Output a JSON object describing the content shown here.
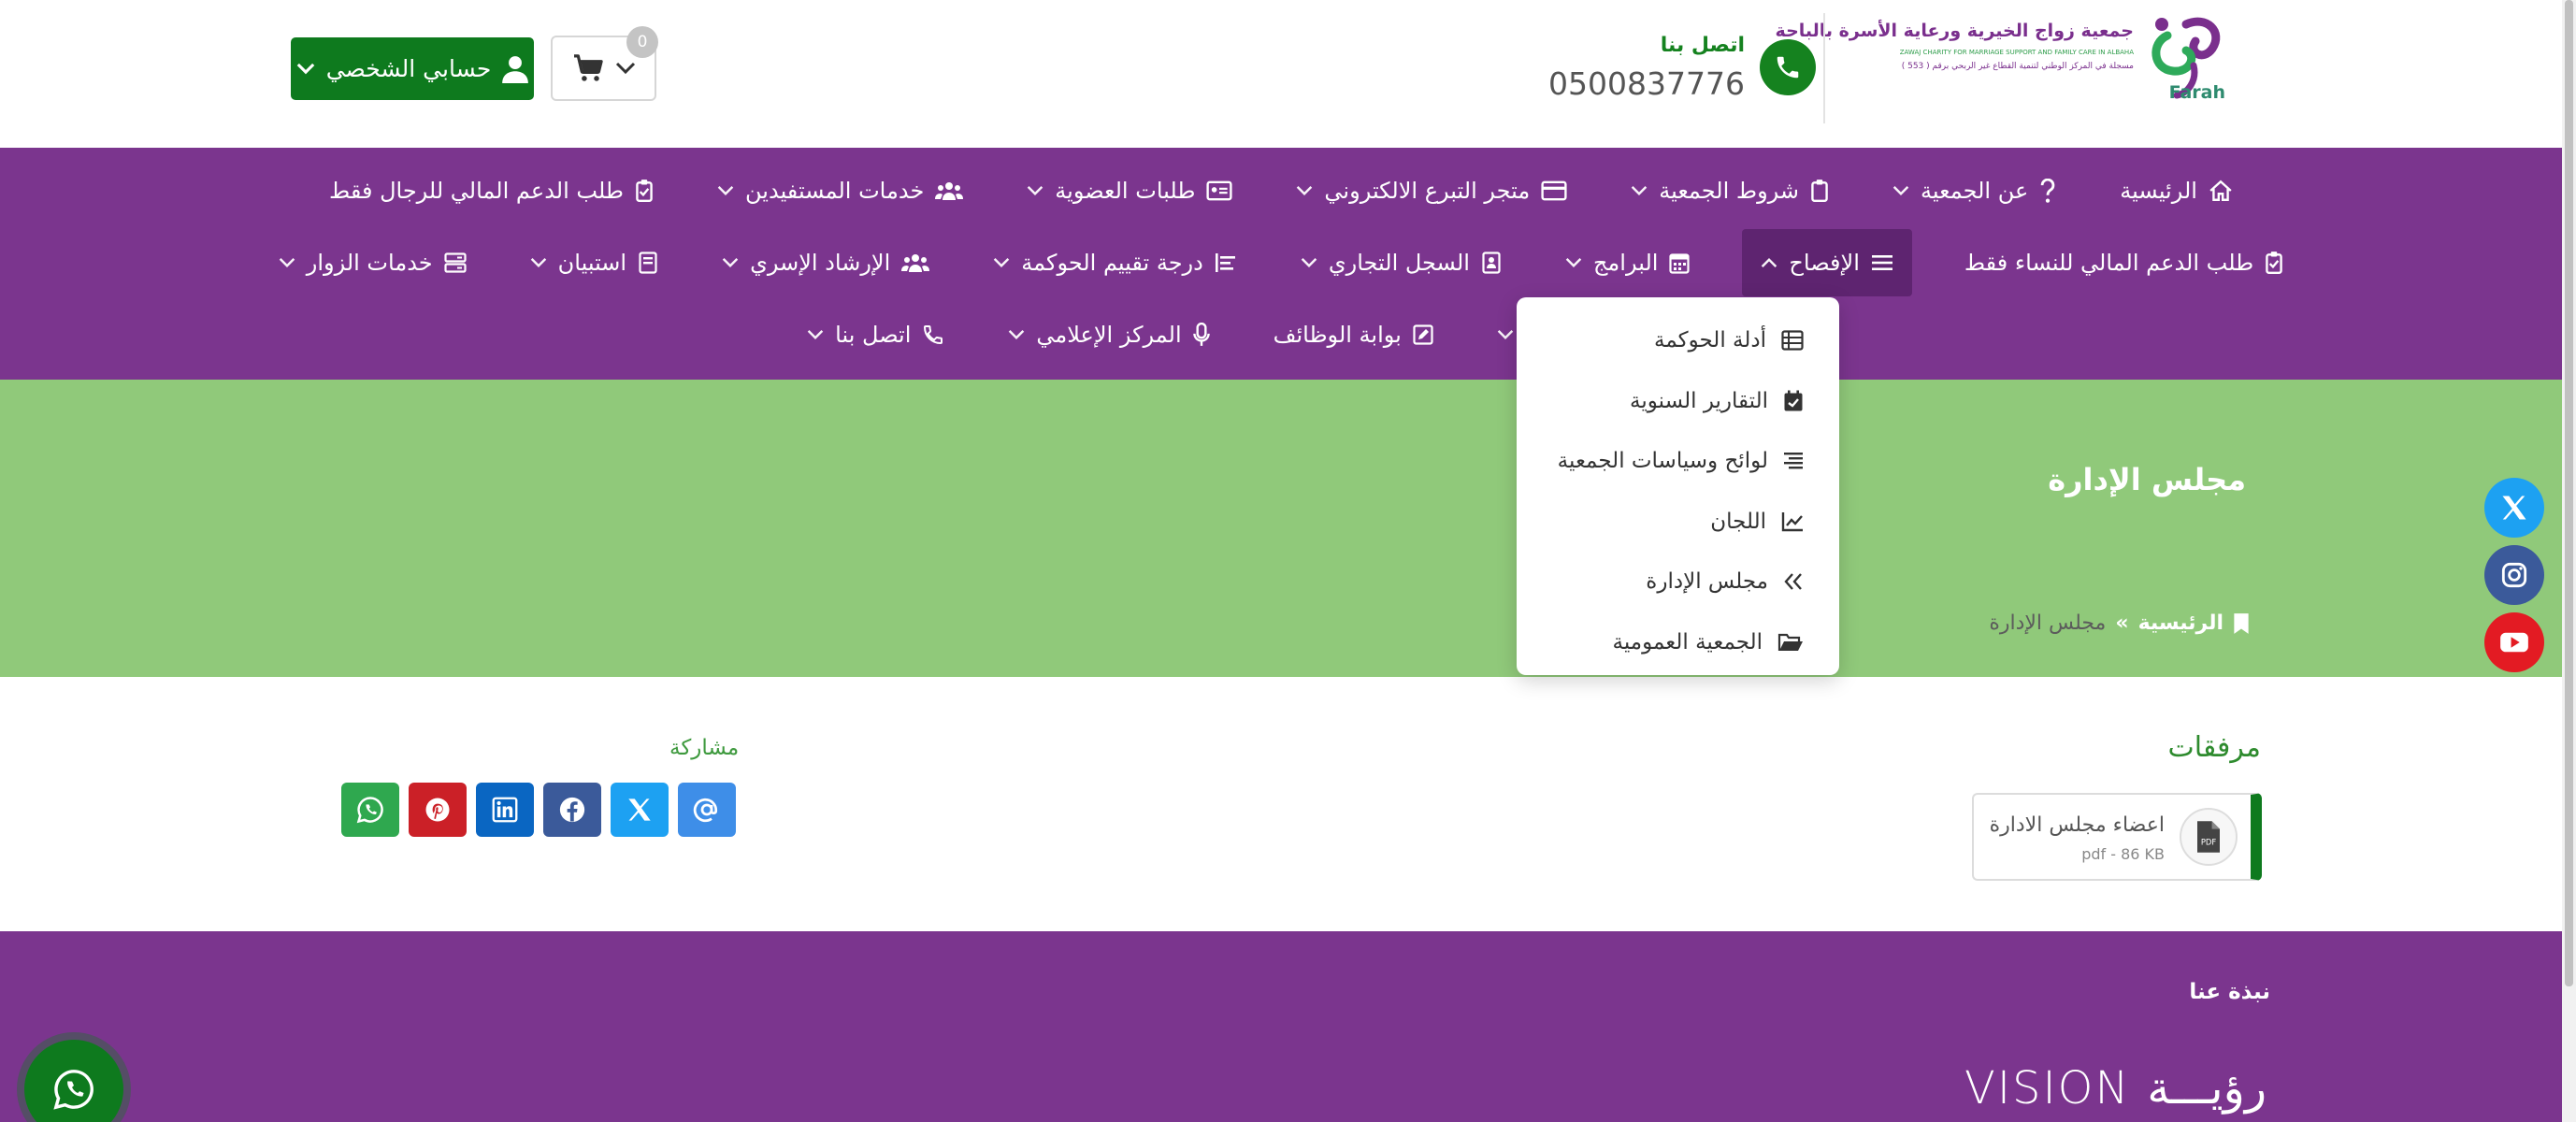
{
  "header": {
    "logo_text_ar": "جمعية زواج الخيرية ورعاية الأسرة بالباحة",
    "logo_text_en": "ZAWAJ CHARITY FOR MARRIAGE SUPPORT AND FAMILY CARE IN ALBAHA",
    "logo_text_reg": "مسجلة في المركز الوطني لتنمية القطاع غير الربحي برقم ( 553 )",
    "logo_brand": "Farah",
    "contact_label": "اتصل بنا",
    "contact_number": "0500837776",
    "cart_count": "0",
    "account_label": "حسابي الشخصي"
  },
  "nav": {
    "row1": [
      {
        "label": "الرئيسية",
        "icon": "home-icon",
        "dropdown": false
      },
      {
        "label": "عن الجمعية",
        "icon": "question-icon",
        "dropdown": true
      },
      {
        "label": "شروط الجمعية",
        "icon": "clipboard-icon",
        "dropdown": true
      },
      {
        "label": "متجر التبرع الالكتروني",
        "icon": "credit-card-icon",
        "dropdown": true
      },
      {
        "label": "طلبات العضوية",
        "icon": "id-card-icon",
        "dropdown": true
      },
      {
        "label": "خدمات المستفيدين",
        "icon": "users-icon",
        "dropdown": true
      },
      {
        "label": "طلب الدعم المالي للرجال فقط",
        "icon": "clipboard-check-icon",
        "dropdown": false
      }
    ],
    "row2": [
      {
        "label": "طلب الدعم المالي للنساء فقط",
        "icon": "clipboard-check-icon",
        "dropdown": false
      },
      {
        "label": "الإفصاح",
        "icon": "bars-icon",
        "dropdown": true,
        "active": true
      },
      {
        "label": "البرامج",
        "icon": "calendar-icon",
        "dropdown": true
      },
      {
        "label": "السجل التجاري",
        "icon": "address-book-icon",
        "dropdown": true
      },
      {
        "label": "درجة تقييم الحوكمة",
        "icon": "bars-staggered-icon",
        "dropdown": true
      },
      {
        "label": "الإرشاد الإسري",
        "icon": "users-icon",
        "dropdown": true
      },
      {
        "label": "استبيان",
        "icon": "book-icon",
        "dropdown": true
      },
      {
        "label": "خدمات الزوار",
        "icon": "server-icon",
        "dropdown": true
      }
    ],
    "row3": [
      {
        "label": "",
        "icon": "",
        "dropdown": true
      },
      {
        "label": "بوابة الوظائف",
        "icon": "edit-square-icon",
        "dropdown": false
      },
      {
        "label": "المركز الإعلامي",
        "icon": "microphone-icon",
        "dropdown": true
      },
      {
        "label": "اتصل بنا",
        "icon": "phone-icon",
        "dropdown": true
      }
    ]
  },
  "dropdown": {
    "items": [
      {
        "label": "أدلة الحوكمة",
        "icon": "table-list-icon"
      },
      {
        "label": "التقارير السنوية",
        "icon": "calendar-check-icon"
      },
      {
        "label": "لوائح وسياسات الجمعية",
        "icon": "list-lines-icon"
      },
      {
        "label": "اللجان",
        "icon": "chart-line-icon"
      },
      {
        "label": "مجلس الإدارة",
        "icon": "angles-left-icon"
      },
      {
        "label": "الجمعية العمومية",
        "icon": "folder-open-icon"
      }
    ]
  },
  "banner": {
    "title": "مجلس الإدارة",
    "breadcrumb_home": "الرئيسية",
    "breadcrumb_sep": "»",
    "breadcrumb_current": "مجلس الإدارة"
  },
  "attachments": {
    "title": "مرفقات",
    "file_name": "اعضاء مجلس الادارة",
    "file_meta": "pdf - 86 KB"
  },
  "share": {
    "label": "مشاركة"
  },
  "footer": {
    "about_title": "نبذة عنا",
    "vision_ar": "رؤيـــة",
    "vision_en": "VISION"
  },
  "colors": {
    "purple": "#7b358e",
    "green": "#0e7a1e",
    "banner_green": "#90c97a"
  }
}
